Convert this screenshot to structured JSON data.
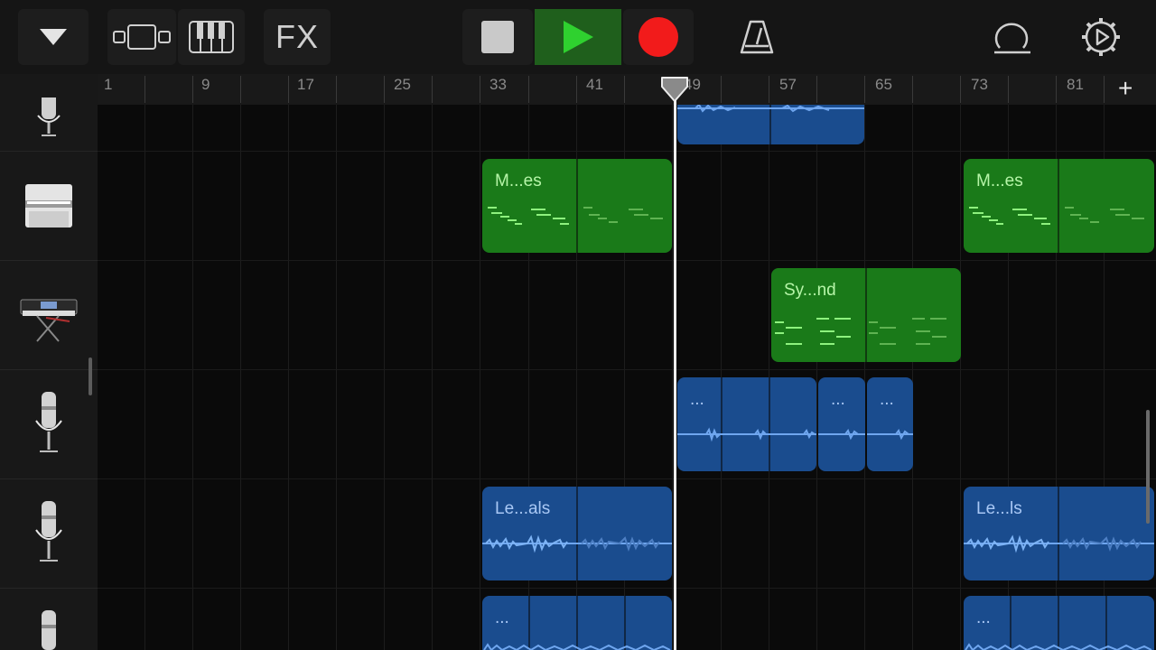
{
  "toolbar": {
    "fx_label": "FX",
    "colors": {
      "play_active": "#1f5f1c",
      "play_icon": "#2fd12f",
      "record": "#f21b1b",
      "stop": "#c9c9c9"
    }
  },
  "ruler": {
    "numbers": [
      "1",
      "9",
      "17",
      "25",
      "33",
      "41",
      "49",
      "57",
      "65",
      "73",
      "81"
    ],
    "add_label": "+"
  },
  "tracks": [
    {
      "icon": "microphone-icon"
    },
    {
      "icon": "organ-icon"
    },
    {
      "icon": "synth-keyboard-icon"
    },
    {
      "icon": "microphone-icon"
    },
    {
      "icon": "microphone-icon"
    },
    {
      "icon": "microphone-icon"
    }
  ],
  "regions": [
    {
      "name": "M...es",
      "color": "#1a7a19"
    },
    {
      "name": "M...es",
      "color": "#1a7a19"
    },
    {
      "name": "Sy...nd",
      "color": "#1a7a19"
    },
    {
      "name": "...",
      "color": "#1a4c8e"
    },
    {
      "name": "...",
      "color": "#1a4c8e"
    },
    {
      "name": "...",
      "color": "#1a4c8e"
    },
    {
      "name": "Le...als",
      "color": "#1a4c8e"
    },
    {
      "name": "Le...ls",
      "color": "#1a4c8e"
    },
    {
      "name": "...",
      "color": "#1a4c8e"
    },
    {
      "name": "...",
      "color": "#1a4c8e"
    }
  ]
}
